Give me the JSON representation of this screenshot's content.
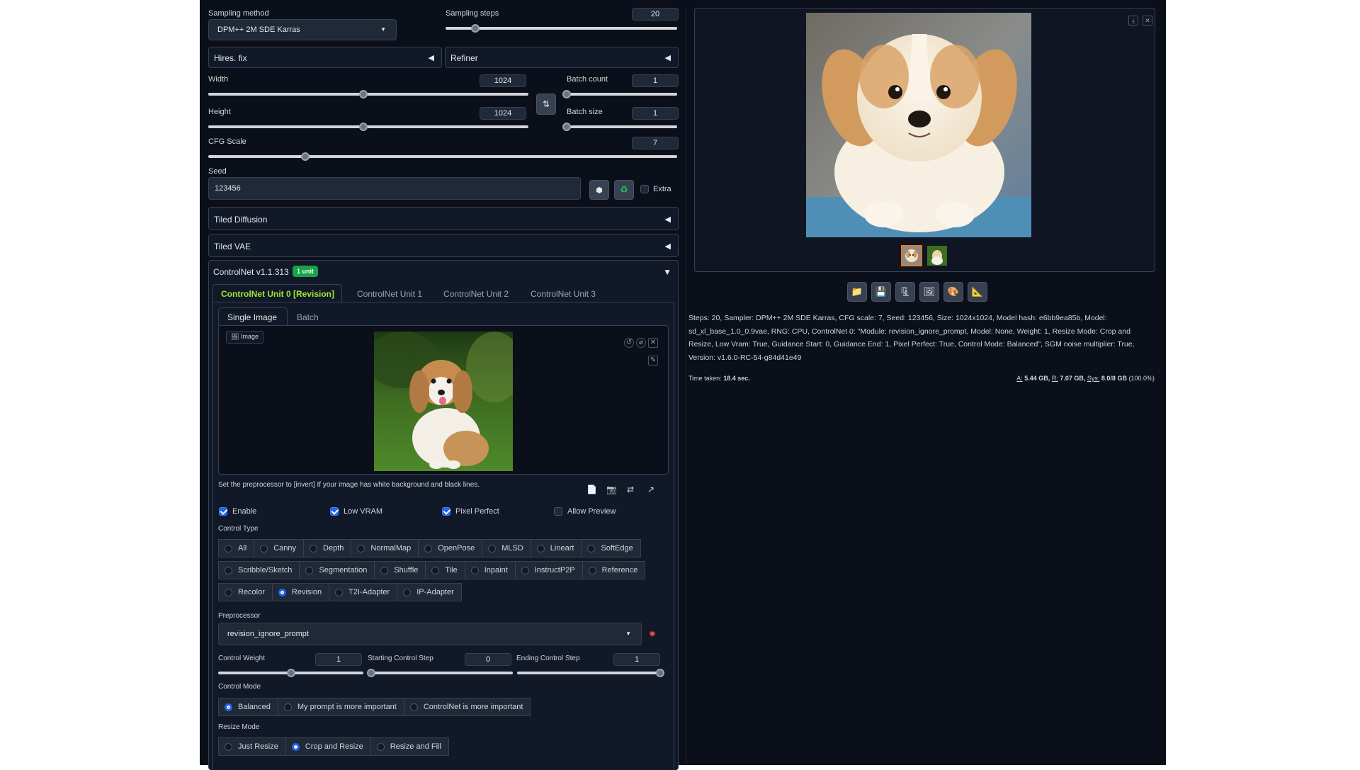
{
  "sampling": {
    "method_label": "Sampling method",
    "method_value": "DPM++ 2M SDE Karras",
    "steps_label": "Sampling steps",
    "steps_value": "20",
    "steps": 20,
    "steps_max": 150
  },
  "hires": {
    "label": "Hires. fix"
  },
  "refiner": {
    "label": "Refiner"
  },
  "width": {
    "label": "Width",
    "value": "1024",
    "v": 1024,
    "max": 2048
  },
  "height": {
    "label": "Height",
    "value": "1024",
    "v": 1024,
    "max": 2048
  },
  "batch_count": {
    "label": "Batch count",
    "value": "1",
    "v": 1,
    "max": 100
  },
  "batch_size": {
    "label": "Batch size",
    "value": "1",
    "v": 1,
    "max": 8
  },
  "cfg": {
    "label": "CFG Scale",
    "value": "7",
    "v": 7,
    "max": 30
  },
  "seed": {
    "label": "Seed",
    "value": "123456",
    "extra_label": "Extra"
  },
  "tiled_diffusion": {
    "label": "Tiled Diffusion"
  },
  "tiled_vae": {
    "label": "Tiled VAE"
  },
  "controlnet": {
    "title": "ControlNet v1.1.313",
    "badge": "1 unit",
    "unit_tabs": [
      "ControlNet Unit 0 [Revision]",
      "ControlNet Unit 1",
      "ControlNet Unit 2",
      "ControlNet Unit 3"
    ],
    "image_tabs": [
      "Single Image",
      "Batch"
    ],
    "image_label": "Image",
    "hint": "Set the preprocessor to [invert] If your image has white background and black lines.",
    "enable": "Enable",
    "low_vram": "Low VRAM",
    "pixel_perfect": "Pixel Perfect",
    "allow_preview": "Allow Preview",
    "control_type_label": "Control Type",
    "control_types": [
      [
        "All",
        "Canny",
        "Depth",
        "NormalMap",
        "OpenPose",
        "MLSD",
        "Lineart",
        "SoftEdge"
      ],
      [
        "Scribble/Sketch",
        "Segmentation",
        "Shuffle",
        "Tile",
        "Inpaint",
        "InstructP2P",
        "Reference"
      ],
      [
        "Recolor",
        "Revision",
        "T2I-Adapter",
        "IP-Adapter"
      ]
    ],
    "selected_type": "Revision",
    "preprocessor_label": "Preprocessor",
    "preprocessor_value": "revision_ignore_prompt",
    "weight_label": "Control Weight",
    "weight_value": "1",
    "weight": 1,
    "weight_max": 2,
    "start_label": "Starting Control Step",
    "start_value": "0",
    "start": 0,
    "end_label": "Ending Control Step",
    "end_value": "1",
    "end": 1,
    "mode_label": "Control Mode",
    "modes": [
      "Balanced",
      "My prompt is more important",
      "ControlNet is more important"
    ],
    "selected_mode": "Balanced",
    "resize_label": "Resize Mode",
    "resize_modes": [
      "Just Resize",
      "Crop and Resize",
      "Resize and Fill"
    ],
    "selected_resize": "Crop and Resize"
  },
  "output": {
    "info": "Steps: 20, Sampler: DPM++ 2M SDE Karras, CFG scale: 7, Seed: 123456, Size: 1024x1024, Model hash: e6bb9ea85b, Model: sd_xl_base_1.0_0.9vae, RNG: CPU, ControlNet 0: \"Module: revision_ignore_prompt, Model: None, Weight: 1, Resize Mode: Crop and Resize, Low Vram: True, Guidance Start: 0, Guidance End: 1, Pixel Perfect: True, Control Mode: Balanced\", SGM noise multiplier: True, Version: v1.6.0-RC-54-g84d41e49",
    "time_label": "Time taken:",
    "time_value": "18.4 sec.",
    "mem_a_label": "A:",
    "mem_a": "5.44 GB,",
    "mem_r_label": "R:",
    "mem_r": "7.07 GB,",
    "mem_sys_label": "Sys:",
    "mem_sys": "8.0/8 GB",
    "mem_pct": "(100.0%)"
  }
}
